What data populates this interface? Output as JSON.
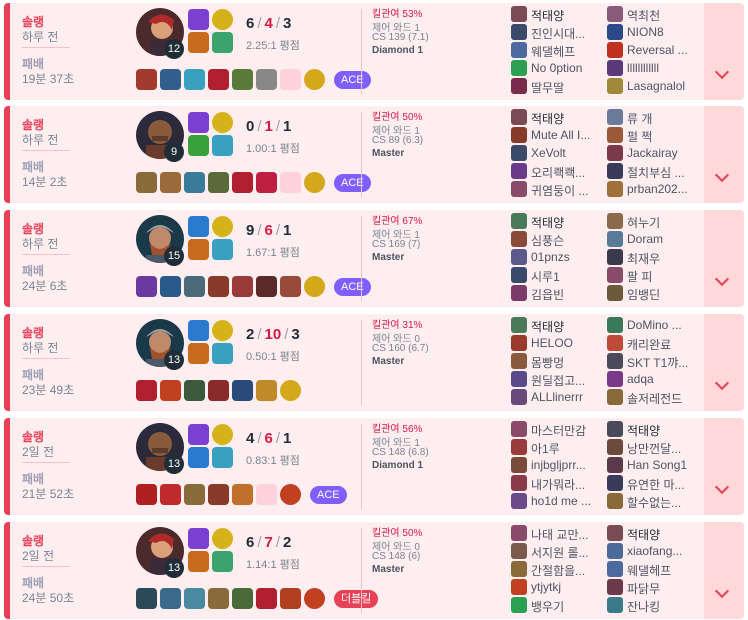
{
  "matches": [
    {
      "mode": "솔랭",
      "when": "하루 전",
      "result": "패배",
      "duration": "19분 37초",
      "champion": "champion-portrait-woman",
      "level": "12",
      "kills": "6",
      "deaths": "4",
      "assists": "3",
      "ratio": "2.25:1 평점",
      "spells": [
        "#7b3fd1",
        "#c96b1c"
      ],
      "runes": [
        "#d4b21a",
        "#3aa36e"
      ],
      "items": [
        "#a33a2f",
        "#2f5f8a",
        "#3aa0c0",
        "#b02030",
        "#5a7a3a",
        "#888888",
        "#ffd1d8",
        "#d4a81a"
      ],
      "badge": "ACE",
      "badge_type": "ace",
      "kp": "킬관여 53%",
      "ward": "제어 와드 1",
      "cs": "CS 139 (7.1)",
      "tier": "Diamond 1",
      "team1": [
        "적태양",
        "진인시대...",
        "웨댈헤프",
        "No 0ption",
        "딸무딸"
      ],
      "team2": [
        "역최천",
        "NION8",
        "Reversal ...",
        "llllllllllll",
        "Lasagnalol"
      ],
      "team1_colors": [
        "#7a4b52",
        "#3a4b6a",
        "#4a6aa0",
        "#2aa050",
        "#7a2a4a"
      ],
      "team2_colors": [
        "#8a5a7a",
        "#2a4a8a",
        "#c03020",
        "#5a3a7a",
        "#a08a3a"
      ]
    },
    {
      "mode": "솔랭",
      "when": "하루 전",
      "result": "패배",
      "duration": "14분 2초",
      "champion": "champion-portrait-man",
      "level": "9",
      "kills": "0",
      "deaths": "1",
      "assists": "1",
      "ratio": "1.00:1 평점",
      "spells": [
        "#7b3fd1",
        "#3aa03a"
      ],
      "runes": [
        "#d4b21a",
        "#3aa0c0"
      ],
      "items": [
        "#8a6a3a",
        "#9a6a3a",
        "#3a7a9a",
        "#5a6a3a",
        "#b02030",
        "#c02040",
        "#ffd1d8",
        "#d4a81a"
      ],
      "badge": "ACE",
      "badge_type": "ace",
      "kp": "킬관여 50%",
      "ward": "제어 와드 1",
      "cs": "CS 89 (6.3)",
      "tier": "Master",
      "team1": [
        "적태양",
        "Mute All I...",
        "XeVolt",
        "오리쾍쾍...",
        "귀염둥이 ..."
      ],
      "team2": [
        "류 개",
        "펄 쩍",
        "Jackairay",
        "절치부심 ...",
        "prban202..."
      ],
      "team1_colors": [
        "#7a4b52",
        "#8a3a2a",
        "#3a4a6a",
        "#6a3a8a",
        "#8a4a6a"
      ],
      "team2_colors": [
        "#6a7a9a",
        "#9a5a3a",
        "#7a3a4a",
        "#3a3a5a",
        "#a0703a"
      ]
    },
    {
      "mode": "솔랭",
      "when": "하루 전",
      "result": "패배",
      "duration": "24분 6초",
      "champion": "champion-portrait-warrior",
      "level": "15",
      "kills": "9",
      "deaths": "6",
      "assists": "1",
      "ratio": "1.67:1 평점",
      "spells": [
        "#2a7ad0",
        "#c96b1c"
      ],
      "runes": [
        "#d4b21a",
        "#3aa0c0"
      ],
      "items": [
        "#6a3aa0",
        "#2a5a8a",
        "#4a6a7a",
        "#8a3a2a",
        "#9a3a3a",
        "#5a2a2a",
        "#9a4a3a",
        "#d4a81a"
      ],
      "badge": "ACE",
      "badge_type": "ace",
      "kp": "킬관여 67%",
      "ward": "제어 와드 1",
      "cs": "CS 169 (7)",
      "tier": "Master",
      "team1": [
        "적태양",
        "심풍슨",
        "01pnzs",
        "시루1",
        "김읍빈"
      ],
      "team2": [
        "혀누기",
        "Doram",
        "최재우",
        "팔 피",
        "임뱅딘"
      ],
      "team1_colors": [
        "#4a7a5a",
        "#8a4a3a",
        "#5a5a8a",
        "#3a4a6a",
        "#7a3a6a"
      ],
      "team2_colors": [
        "#8a6a4a",
        "#5a7a9a",
        "#3a3a4a",
        "#8a4a6a",
        "#6a5a3a"
      ]
    },
    {
      "mode": "솔랭",
      "when": "하루 전",
      "result": "패배",
      "duration": "23분 49초",
      "champion": "champion-portrait-warrior",
      "level": "13",
      "kills": "2",
      "deaths": "10",
      "assists": "3",
      "ratio": "0.50:1 평점",
      "spells": [
        "#2a7ad0",
        "#c96b1c"
      ],
      "runes": [
        "#d4b21a",
        "#3aa0c0"
      ],
      "items": [
        "#b02030",
        "#c04020",
        "#3a5a3a",
        "#8a2a2a",
        "#2a4a7a",
        "#c08a2a",
        "#d4a81a"
      ],
      "badge": "",
      "badge_type": "none",
      "kp": "킬관여 31%",
      "ward": "제어 와드 0",
      "cs": "CS 160 (6.7)",
      "tier": "Master",
      "team1": [
        "적태양",
        "HELOO",
        "몸빵멍",
        "원딜접고...",
        "ALLlinerrr"
      ],
      "team2": [
        "DoMino ...",
        "캐리완료",
        "SKT T1꺄...",
        "adqa",
        "솔저레전드"
      ],
      "team1_colors": [
        "#4a7a5a",
        "#9a3a2a",
        "#8a5a3a",
        "#5a4a8a",
        "#6a4a7a"
      ],
      "team2_colors": [
        "#3a7a5a",
        "#c04a3a",
        "#4a4a5a",
        "#7a3a8a",
        "#8a6a3a"
      ]
    },
    {
      "mode": "솔랭",
      "when": "2일 전",
      "result": "패배",
      "duration": "21분 52초",
      "champion": "champion-portrait-man",
      "level": "13",
      "kills": "4",
      "deaths": "6",
      "assists": "1",
      "ratio": "0.83:1 평점",
      "spells": [
        "#7b3fd1",
        "#2a7ad0"
      ],
      "runes": [
        "#d4b21a",
        "#3aa0c0"
      ],
      "items": [
        "#b02020",
        "#c02a2a",
        "#8a6a3a",
        "#8a3a2a",
        "#c0702a",
        "#ffd1d8",
        "#c04020"
      ],
      "badge": "ACE",
      "badge_type": "ace",
      "kp": "킬관여 56%",
      "ward": "제어 와드 1",
      "cs": "CS 148 (6.8)",
      "tier": "Diamond 1",
      "team1": [
        "마스터만감",
        "아1루",
        "injbgljprr...",
        "내가뭐라...",
        "ho1d me ..."
      ],
      "team2": [
        "적태양",
        "낭만껀달...",
        "Han Song1",
        "유연한 마...",
        "할수없는..."
      ],
      "team1_colors": [
        "#8a4a6a",
        "#9a3a3a",
        "#7a4a3a",
        "#8a3a4a",
        "#6a4a8a"
      ],
      "team2_colors": [
        "#4a4a5a",
        "#6a4a3a",
        "#5a3a4a",
        "#3a3a5a",
        "#8a6a3a"
      ]
    },
    {
      "mode": "솔랭",
      "when": "2일 전",
      "result": "패배",
      "duration": "24분 50초",
      "champion": "champion-portrait-woman",
      "level": "13",
      "kills": "6",
      "deaths": "7",
      "assists": "2",
      "ratio": "1.14:1 평점",
      "spells": [
        "#7b3fd1",
        "#c96b1c"
      ],
      "runes": [
        "#d4b21a",
        "#3aa36e"
      ],
      "items": [
        "#2a4a5a",
        "#3a6a8a",
        "#4a8aa0",
        "#8a6a3a",
        "#4a6a3a",
        "#b02030",
        "#b04020",
        "#c04020"
      ],
      "badge": "더블킬",
      "badge_type": "dbl",
      "kp": "킬관여 50%",
      "ward": "제어 와드 0",
      "cs": "CS 148 (6)",
      "tier": "Master",
      "team1": [
        "나태 교만...",
        "서지원 롤...",
        "간절함을...",
        "ytjytkj",
        "뱅우기"
      ],
      "team2": [
        "적태양",
        "xiaofang...",
        "웨댈헤프",
        "파닭무",
        "잔나킹"
      ],
      "team1_colors": [
        "#8a4a6a",
        "#7a5a4a",
        "#8a6a3a",
        "#c04020",
        "#2aa050"
      ],
      "team2_colors": [
        "#7a4b52",
        "#4a6a9a",
        "#4a6aa0",
        "#6a3a4a",
        "#3a7a8a"
      ]
    }
  ]
}
